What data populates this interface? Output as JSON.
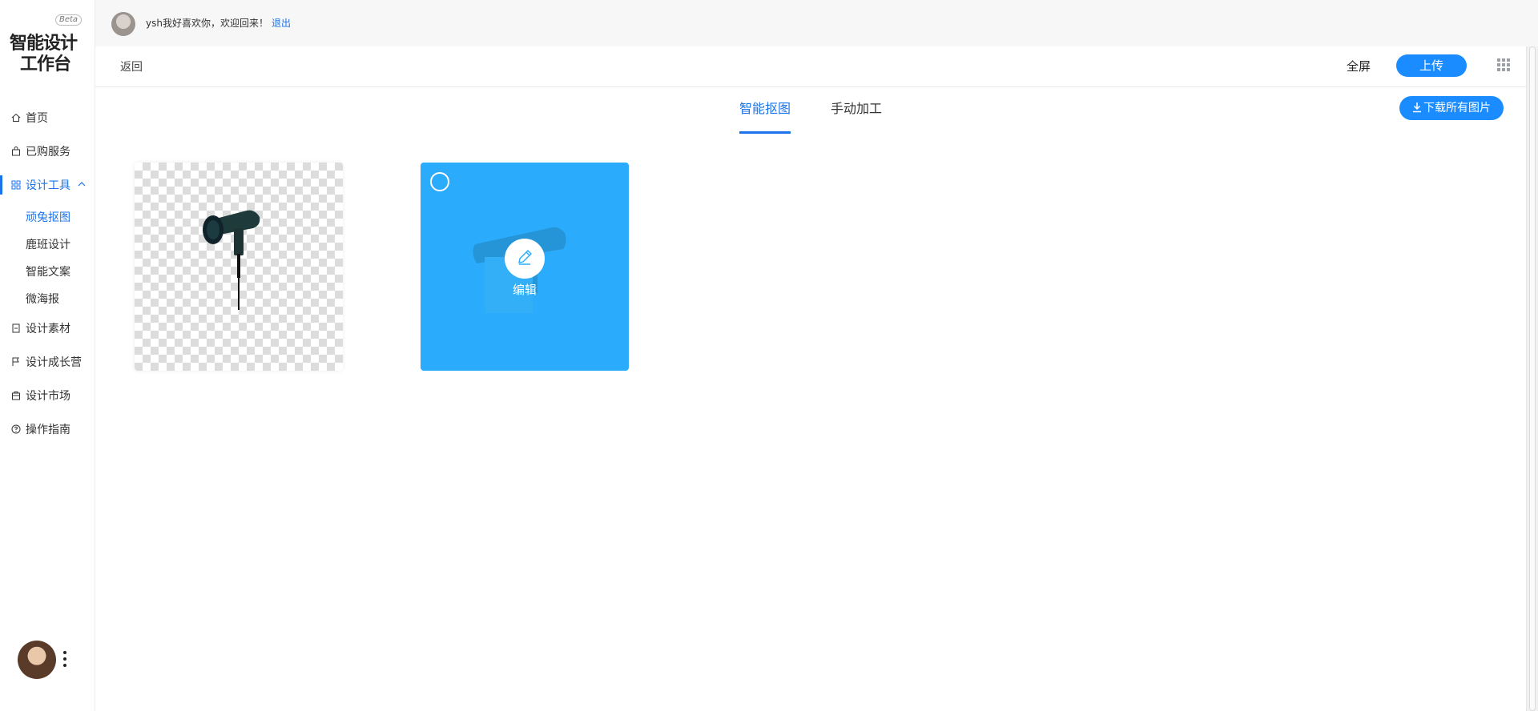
{
  "app": {
    "logo_line1": "智能设计",
    "logo_line2": "工作台",
    "beta": "Beta"
  },
  "user": {
    "welcome": "ysh我好喜欢你，欢迎回来！",
    "logout": "退出"
  },
  "sidebar": {
    "items": [
      {
        "label": "首页",
        "icon": "home-icon"
      },
      {
        "label": "已购服务",
        "icon": "bag-icon"
      },
      {
        "label": "设计工具",
        "icon": "grid-icon",
        "active": true
      },
      {
        "label": "设计素材",
        "icon": "document-icon"
      },
      {
        "label": "设计成长营",
        "icon": "flag-icon"
      },
      {
        "label": "设计市场",
        "icon": "shop-icon"
      },
      {
        "label": "操作指南",
        "icon": "help-icon"
      }
    ],
    "sub_items": [
      {
        "label": "顽兔抠图",
        "active": true
      },
      {
        "label": "鹿班设计"
      },
      {
        "label": "智能文案"
      },
      {
        "label": "微海报"
      }
    ]
  },
  "toolbar": {
    "back": "返回",
    "fullscreen": "全屏",
    "upload": "上传"
  },
  "tabs": [
    {
      "label": "智能抠图",
      "active": true
    },
    {
      "label": "手动加工"
    }
  ],
  "actions": {
    "download_all": "下载所有图片"
  },
  "cards": [
    {
      "type": "cutout-result"
    },
    {
      "type": "selected",
      "edit_label": "编辑"
    }
  ],
  "colors": {
    "accent": "#1a73e8",
    "button": "#1a8cff",
    "selected_card": "#2aabfb"
  }
}
